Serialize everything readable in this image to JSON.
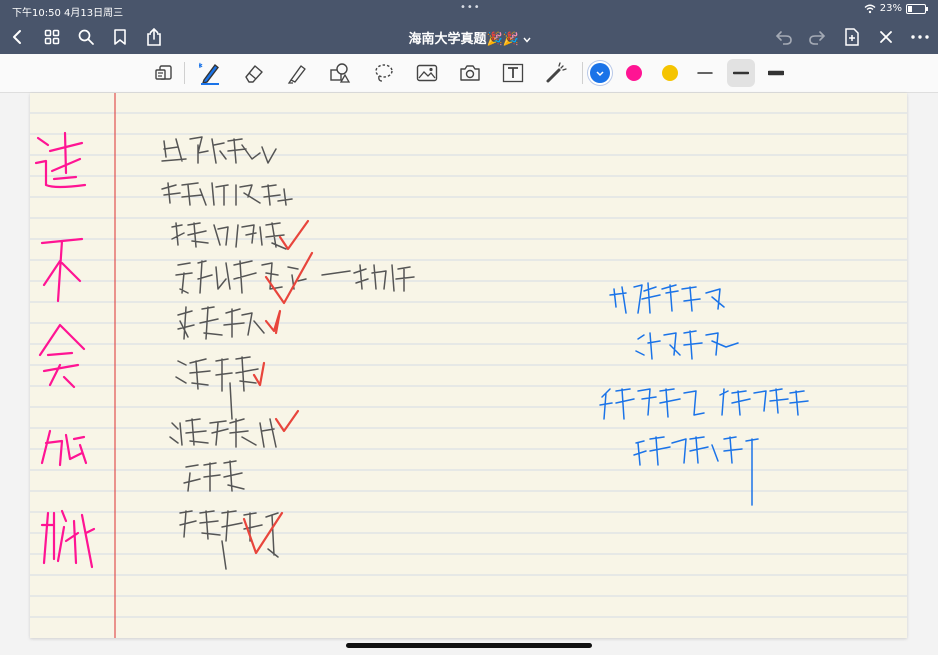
{
  "status": {
    "time": "下午10:50",
    "date": "4月13日周三",
    "battery": "23%"
  },
  "document": {
    "title": "海南大学真题🎉🎉"
  },
  "colors": {
    "nav_bg": "#49556b",
    "pen_blue": "#1a73e8",
    "pen_pink": "#ff1493",
    "pen_yellow": "#f5c400",
    "ink_gray": "#555555",
    "check_red": "#e8453c",
    "margin_red": "#e05050",
    "rule_blue": "#c8d3e6"
  },
  "icons": {
    "back": "chevron-left-icon",
    "grid": "grid-icon",
    "search": "search-icon",
    "bookmark": "bookmark-icon",
    "share": "share-icon",
    "undo": "undo-icon",
    "redo": "redo-icon",
    "add_page": "add-page-icon",
    "close": "close-icon",
    "more": "more-icon",
    "tools": [
      "page-reader-icon",
      "pen-icon",
      "eraser-icon",
      "highlighter-icon",
      "shapes-icon",
      "lasso-icon",
      "image-icon",
      "camera-icon",
      "text-icon",
      "laser-pointer-icon"
    ]
  }
}
